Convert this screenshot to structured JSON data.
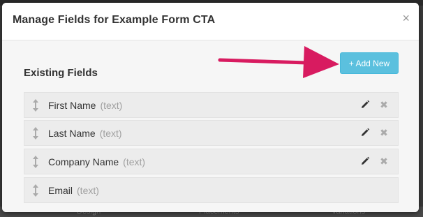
{
  "modal": {
    "title": "Manage Fields for Example Form CTA",
    "close_label": "×"
  },
  "section": {
    "title": "Existing Fields",
    "add_button_label": "+ Add New"
  },
  "fields": [
    {
      "name": "First Name",
      "type": "(text)",
      "editable": true,
      "deletable": true
    },
    {
      "name": "Last Name",
      "type": "(text)",
      "editable": true,
      "deletable": true
    },
    {
      "name": "Company Name",
      "type": "(text)",
      "editable": true,
      "deletable": true
    },
    {
      "name": "Email",
      "type": "(text)",
      "editable": false,
      "deletable": false
    }
  ],
  "background_nav": [
    "Design",
    "Placements",
    "Variations"
  ],
  "colors": {
    "accent": "#5bc0de",
    "annotation_arrow": "#d81b60",
    "row_background": "#ececec"
  },
  "icons": {
    "drag": "drag-vertical-arrows-icon",
    "edit": "pencil-icon",
    "delete": "x-icon",
    "close": "close-icon"
  }
}
